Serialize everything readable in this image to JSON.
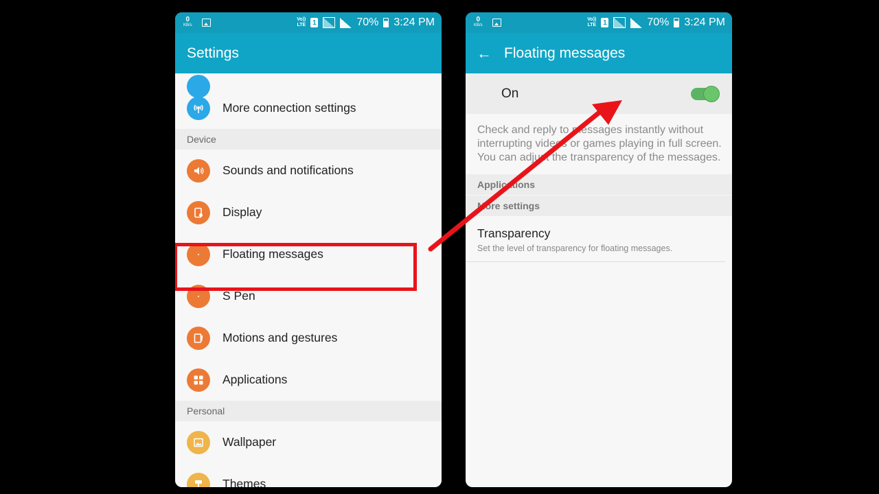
{
  "status_bar": {
    "kbs_value": "0",
    "kbs_unit": "KB/s",
    "volte_top": "Vo))",
    "volte_bottom": "LTE",
    "sim_slot": "1",
    "battery": "70%",
    "time": "3:24 PM"
  },
  "left": {
    "title": "Settings",
    "items_top": [
      {
        "label": "More connection settings",
        "icon": "wifi-tower-icon",
        "color": "blue"
      }
    ],
    "device_header": "Device",
    "device_items": [
      {
        "label": "Sounds and notifications",
        "icon": "speaker-icon"
      },
      {
        "label": "Display",
        "icon": "display-icon"
      },
      {
        "label": "Floating messages",
        "icon": "dot-icon"
      },
      {
        "label": "S Pen",
        "icon": "dot-icon"
      },
      {
        "label": "Motions and gestures",
        "icon": "motion-icon"
      },
      {
        "label": "Applications",
        "icon": "grid-icon"
      }
    ],
    "personal_header": "Personal",
    "personal_items": [
      {
        "label": "Wallpaper",
        "icon": "image-icon"
      },
      {
        "label": "Themes",
        "icon": "brush-icon"
      }
    ]
  },
  "right": {
    "title": "Floating messages",
    "toggle_label": "On",
    "toggle_state": true,
    "description": "Check and reply to messages instantly without interrupting videos or games playing in full screen. You can adjust the transparency of the messages.",
    "header_applications": "Applications",
    "header_more": "More settings",
    "transparency_title": "Transparency",
    "transparency_sub": "Set the level of transparency for floating messages."
  },
  "colors": {
    "status_bar": "#119dbb",
    "app_bar": "#10a5c6",
    "highlight": "#e8141a",
    "toggle_on": "#5cb363"
  }
}
